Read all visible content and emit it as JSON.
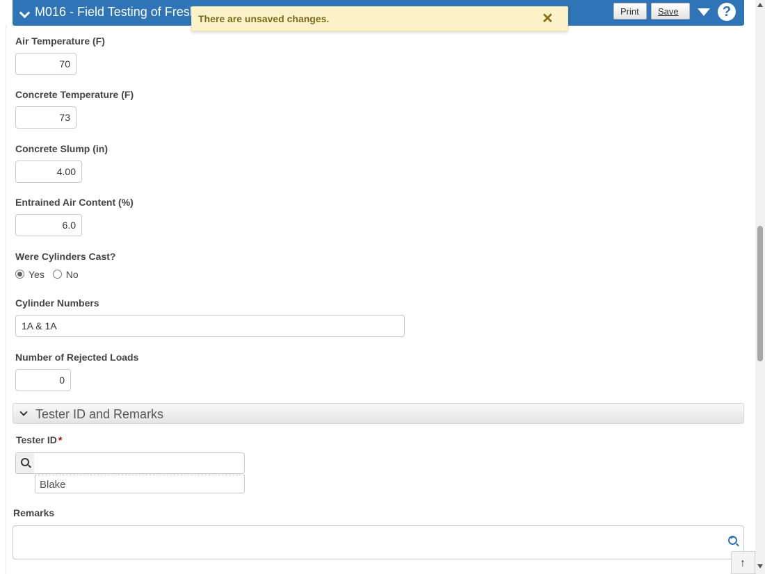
{
  "header": {
    "title": "M016 - Field Testing of Fresh Concrete",
    "print_label": "Print",
    "save_label": "Save",
    "help_label": "?"
  },
  "toast": {
    "message": "There are unsaved changes.",
    "close_glyph": "✕"
  },
  "fields": {
    "air_temperature": {
      "label": "Air Temperature (F)",
      "value": "70"
    },
    "concrete_temperature": {
      "label": "Concrete Temperature (F)",
      "value": "73"
    },
    "concrete_slump": {
      "label": "Concrete Slump (in)",
      "value": "4.00"
    },
    "entrained_air": {
      "label": "Entrained Air Content (%)",
      "value": "6.0"
    },
    "cylinders_cast": {
      "label": "Were Cylinders Cast?",
      "options": [
        "Yes",
        "No"
      ],
      "selected": "Yes"
    },
    "cylinder_numbers": {
      "label": "Cylinder Numbers",
      "value": "1A & 1A"
    },
    "rejected_loads": {
      "label": "Number of Rejected Loads",
      "value": "0"
    }
  },
  "section": {
    "title": "Tester ID and Remarks"
  },
  "tester": {
    "label": "Tester ID",
    "required_mark": "*",
    "description": "Blake"
  },
  "remarks": {
    "label": "Remarks",
    "value": ""
  },
  "colors": {
    "header_bg": "#2f74b7",
    "toast_bg": "#fcf2c9",
    "required": "#b00000"
  }
}
